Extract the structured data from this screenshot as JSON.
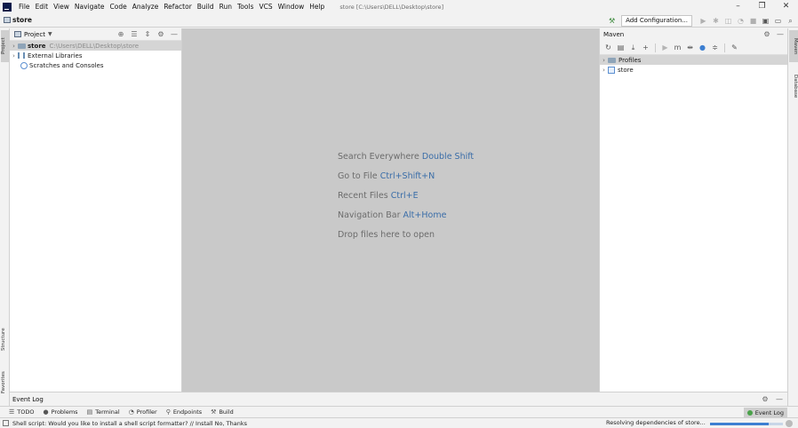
{
  "menu": {
    "items": [
      "File",
      "Edit",
      "View",
      "Navigate",
      "Code",
      "Analyze",
      "Refactor",
      "Build",
      "Run",
      "Tools",
      "VCS",
      "Window",
      "Help"
    ],
    "window_title": "store [C:\\Users\\DELL\\Desktop\\store]"
  },
  "window_controls": {
    "minimize": "–",
    "restore": "❐",
    "close": "✕"
  },
  "navbar": {
    "breadcrumb": "store",
    "add_configuration": "Add Configuration..."
  },
  "left_stripe": {
    "project": "Project",
    "structure": "Structure",
    "favorites": "Favorites"
  },
  "right_stripe": {
    "maven": "Maven",
    "database": "Database"
  },
  "project_panel": {
    "title": "Project",
    "tree": [
      {
        "label": "store",
        "path": "C:\\Users\\DELL\\Desktop\\store"
      },
      {
        "label": "External Libraries"
      },
      {
        "label": "Scratches and Consoles"
      }
    ]
  },
  "editor_hints": [
    {
      "text": "Search Everywhere",
      "shortcut": "Double Shift"
    },
    {
      "text": "Go to File",
      "shortcut": "Ctrl+Shift+N"
    },
    {
      "text": "Recent Files",
      "shortcut": "Ctrl+E"
    },
    {
      "text": "Navigation Bar",
      "shortcut": "Alt+Home"
    },
    {
      "text": "Drop files here to open",
      "shortcut": ""
    }
  ],
  "maven_panel": {
    "title": "Maven",
    "tree": [
      {
        "label": "Profiles"
      },
      {
        "label": "store"
      }
    ]
  },
  "event_log": {
    "title": "Event Log"
  },
  "tool_tabs": [
    {
      "label": "TODO",
      "icon": "list-icon"
    },
    {
      "label": "Problems",
      "icon": "problems-icon"
    },
    {
      "label": "Terminal",
      "icon": "terminal-icon"
    },
    {
      "label": "Profiler",
      "icon": "profiler-icon"
    },
    {
      "label": "Endpoints",
      "icon": "endpoints-icon"
    },
    {
      "label": "Build",
      "icon": "hammer-icon"
    }
  ],
  "event_log_tab": "Event Log",
  "status": {
    "message": "Shell script: Would you like to install a shell script formatter? // Install   No, Thanks",
    "progress_text": "Resolving dependencies of store...",
    "progress": 0.8
  },
  "colors": {
    "accent": "#3d7fd1",
    "editor_background": "#c9c9c9",
    "shortcut": "#3a6da8",
    "run_hammer": "#3d8a3d"
  }
}
